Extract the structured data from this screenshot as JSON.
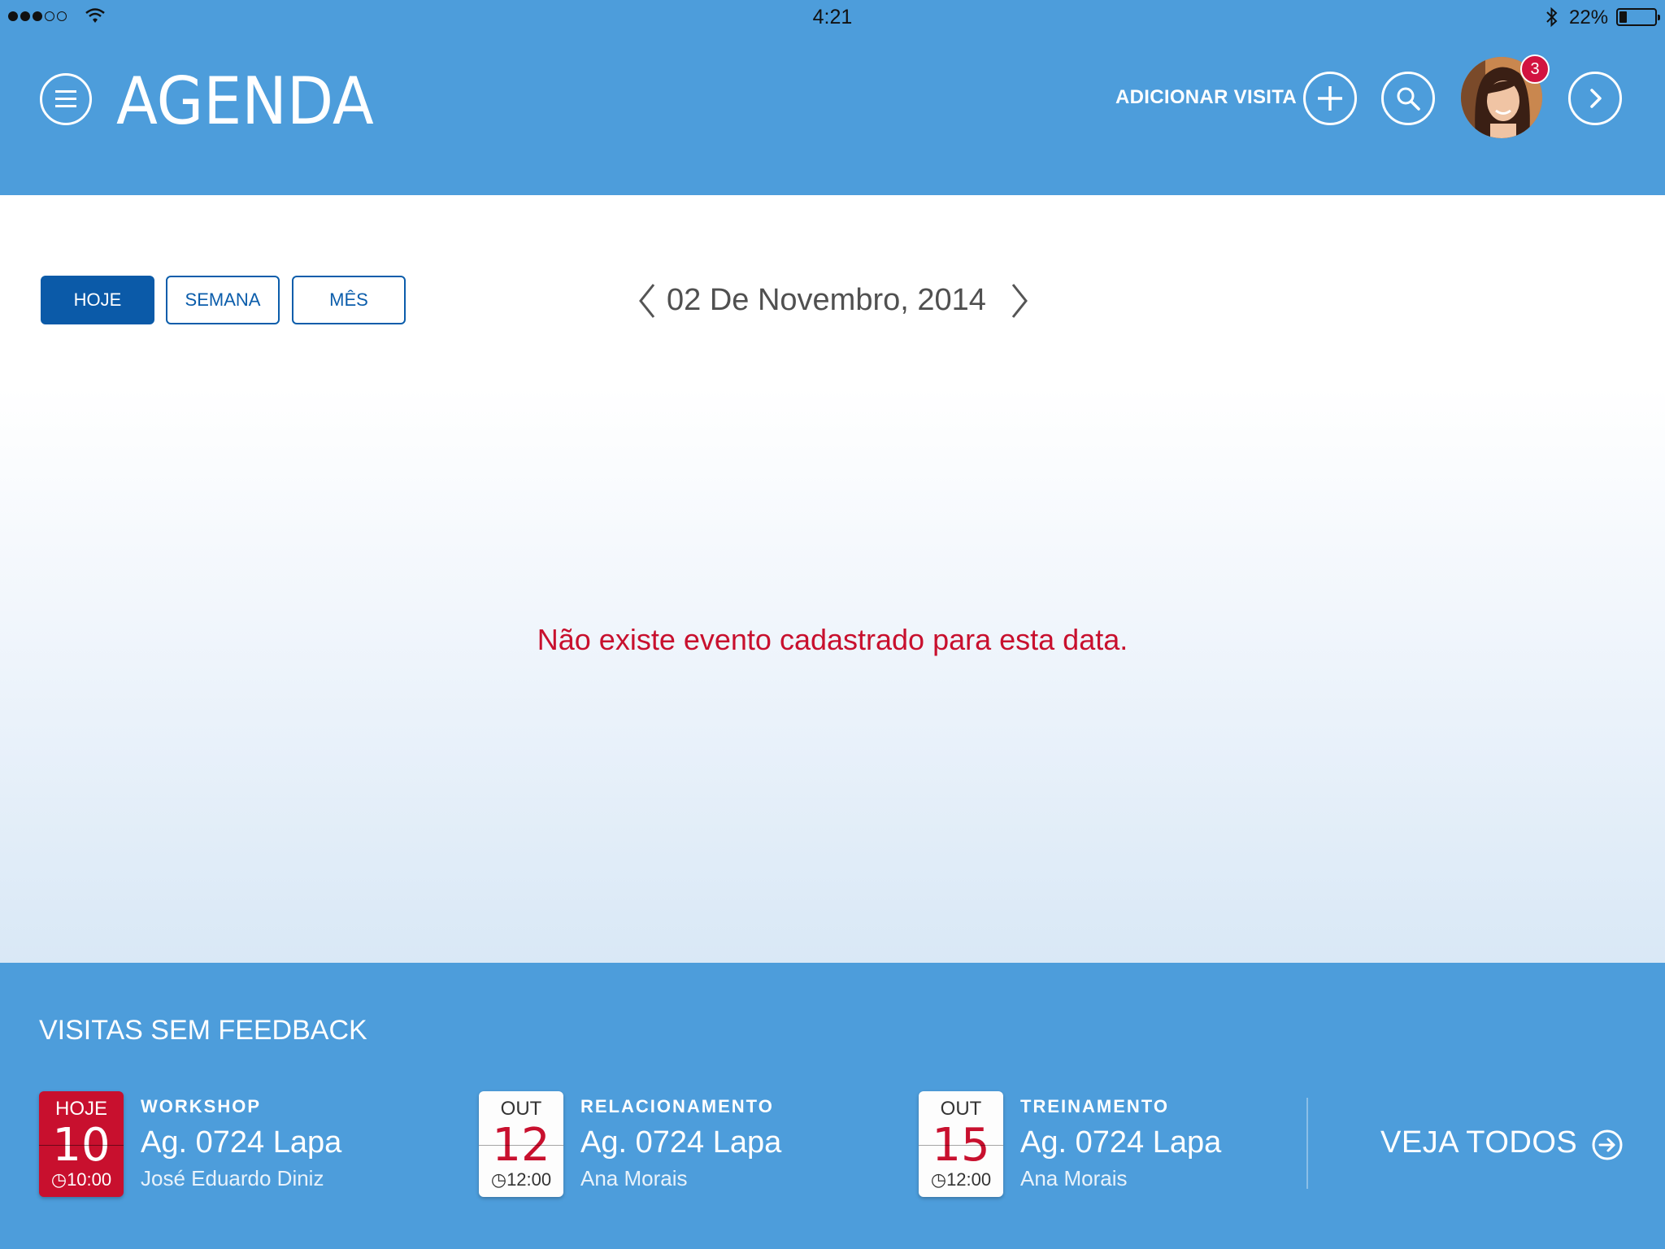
{
  "status_bar": {
    "time": "4:21",
    "battery_percent": "22%",
    "battery_level": 0.22
  },
  "header": {
    "title": "AGENDA",
    "add_visit_label": "ADICIONAR VISITA",
    "notification_count": "3",
    "icons": [
      "menu-icon",
      "plus-icon",
      "search-icon",
      "avatar",
      "chevron-right-icon"
    ]
  },
  "filters": {
    "items": [
      {
        "label": "HOJE",
        "active": true
      },
      {
        "label": "SEMANA",
        "active": false
      },
      {
        "label": "MÊS",
        "active": false
      }
    ]
  },
  "date_nav": {
    "current_date": "02 De Novembro, 2014"
  },
  "main": {
    "empty_message": "Não existe evento cadastrado para esta data."
  },
  "footer": {
    "title": "VISITAS SEM FEEDBACK",
    "visits": [
      {
        "month": "HOJE",
        "day": "10",
        "time": "10:00",
        "type": "WORKSHOP",
        "place": "Ag. 0724 Lapa",
        "person": "José Eduardo Diniz",
        "is_today": true
      },
      {
        "month": "OUT",
        "day": "12",
        "time": "12:00",
        "type": "RELACIONAMENTO",
        "place": "Ag. 0724 Lapa",
        "person": "Ana Morais",
        "is_today": false
      },
      {
        "month": "OUT",
        "day": "15",
        "time": "12:00",
        "type": "TREINAMENTO",
        "place": "Ag. 0724 Lapa",
        "person": "Ana Morais",
        "is_today": false
      }
    ],
    "see_all_label": "VEJA TODOS"
  },
  "colors": {
    "header_blue": "#4d9ddb",
    "active_blue": "#0b5aa8",
    "alert_red": "#c8102e"
  }
}
